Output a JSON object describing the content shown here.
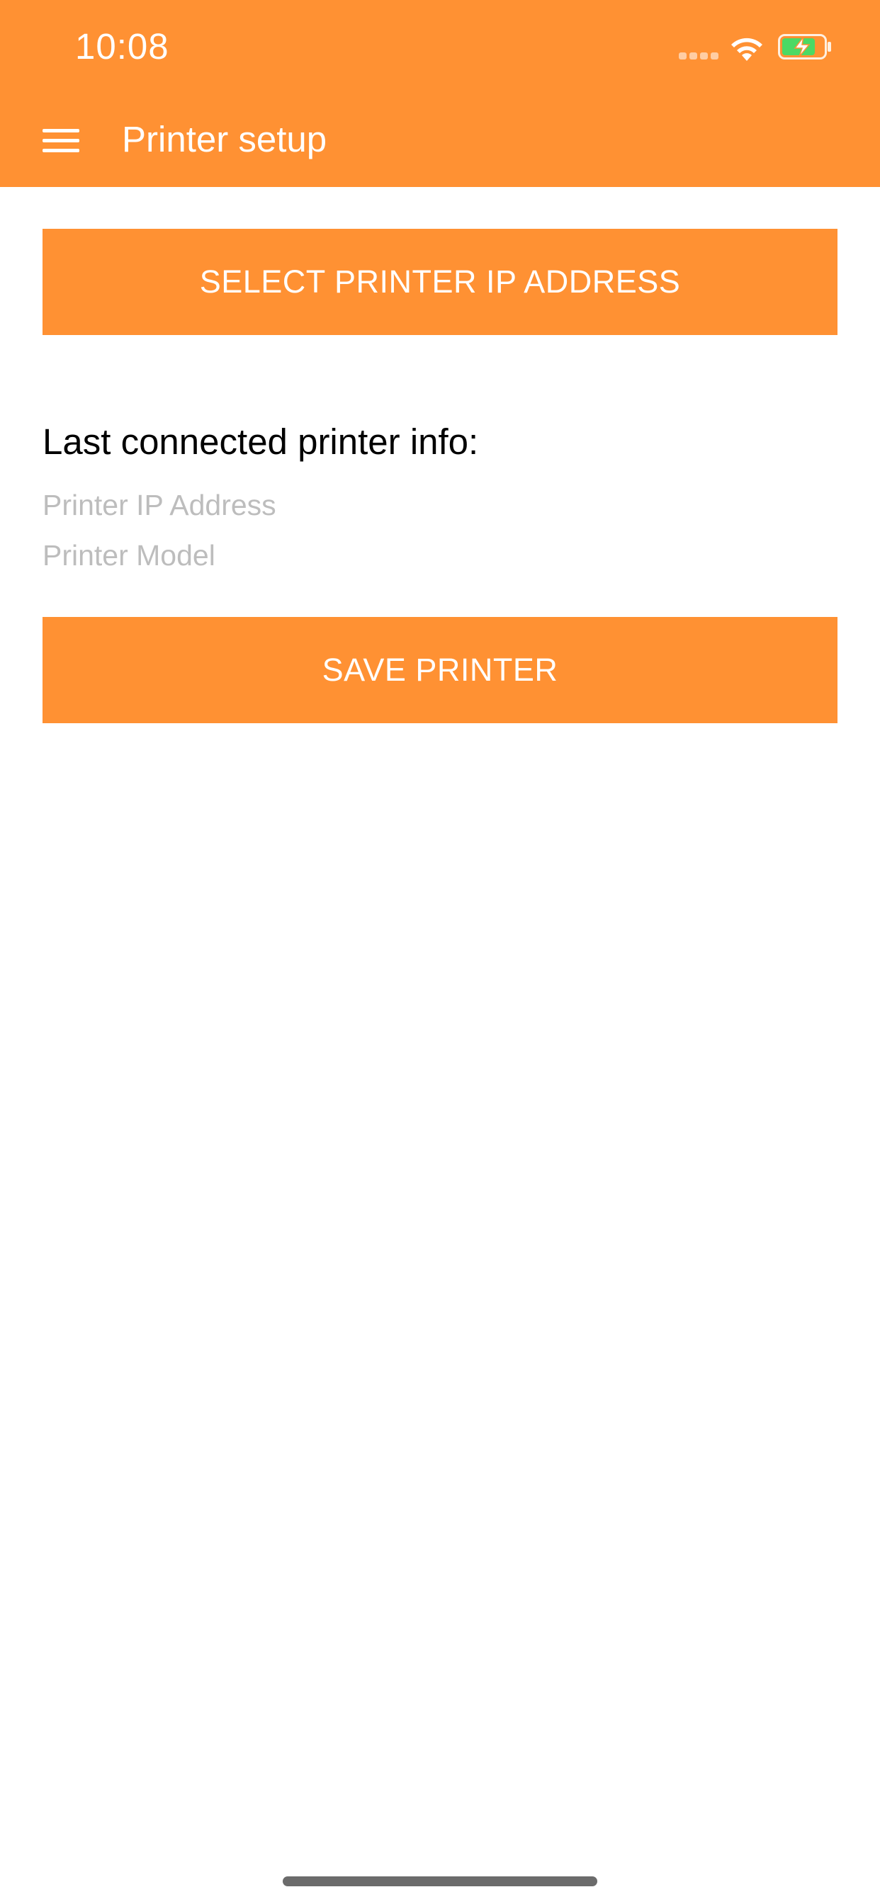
{
  "status_bar": {
    "time": "10:08",
    "icons": [
      "cellular-signal-icon",
      "wifi-icon",
      "battery-charging-icon"
    ]
  },
  "app_bar": {
    "menu_icon": "hamburger-menu-icon",
    "title": "Printer setup"
  },
  "main": {
    "select_button_label": "SELECT PRINTER IP ADDRESS",
    "info_heading": "Last connected printer info:",
    "printer_ip_placeholder": "Printer IP Address",
    "printer_model_placeholder": "Printer Model",
    "save_button_label": "SAVE PRINTER"
  },
  "colors": {
    "accent": "#FF9133",
    "placeholder_text": "#BDBDBD",
    "battery_fill": "#4CD964"
  }
}
